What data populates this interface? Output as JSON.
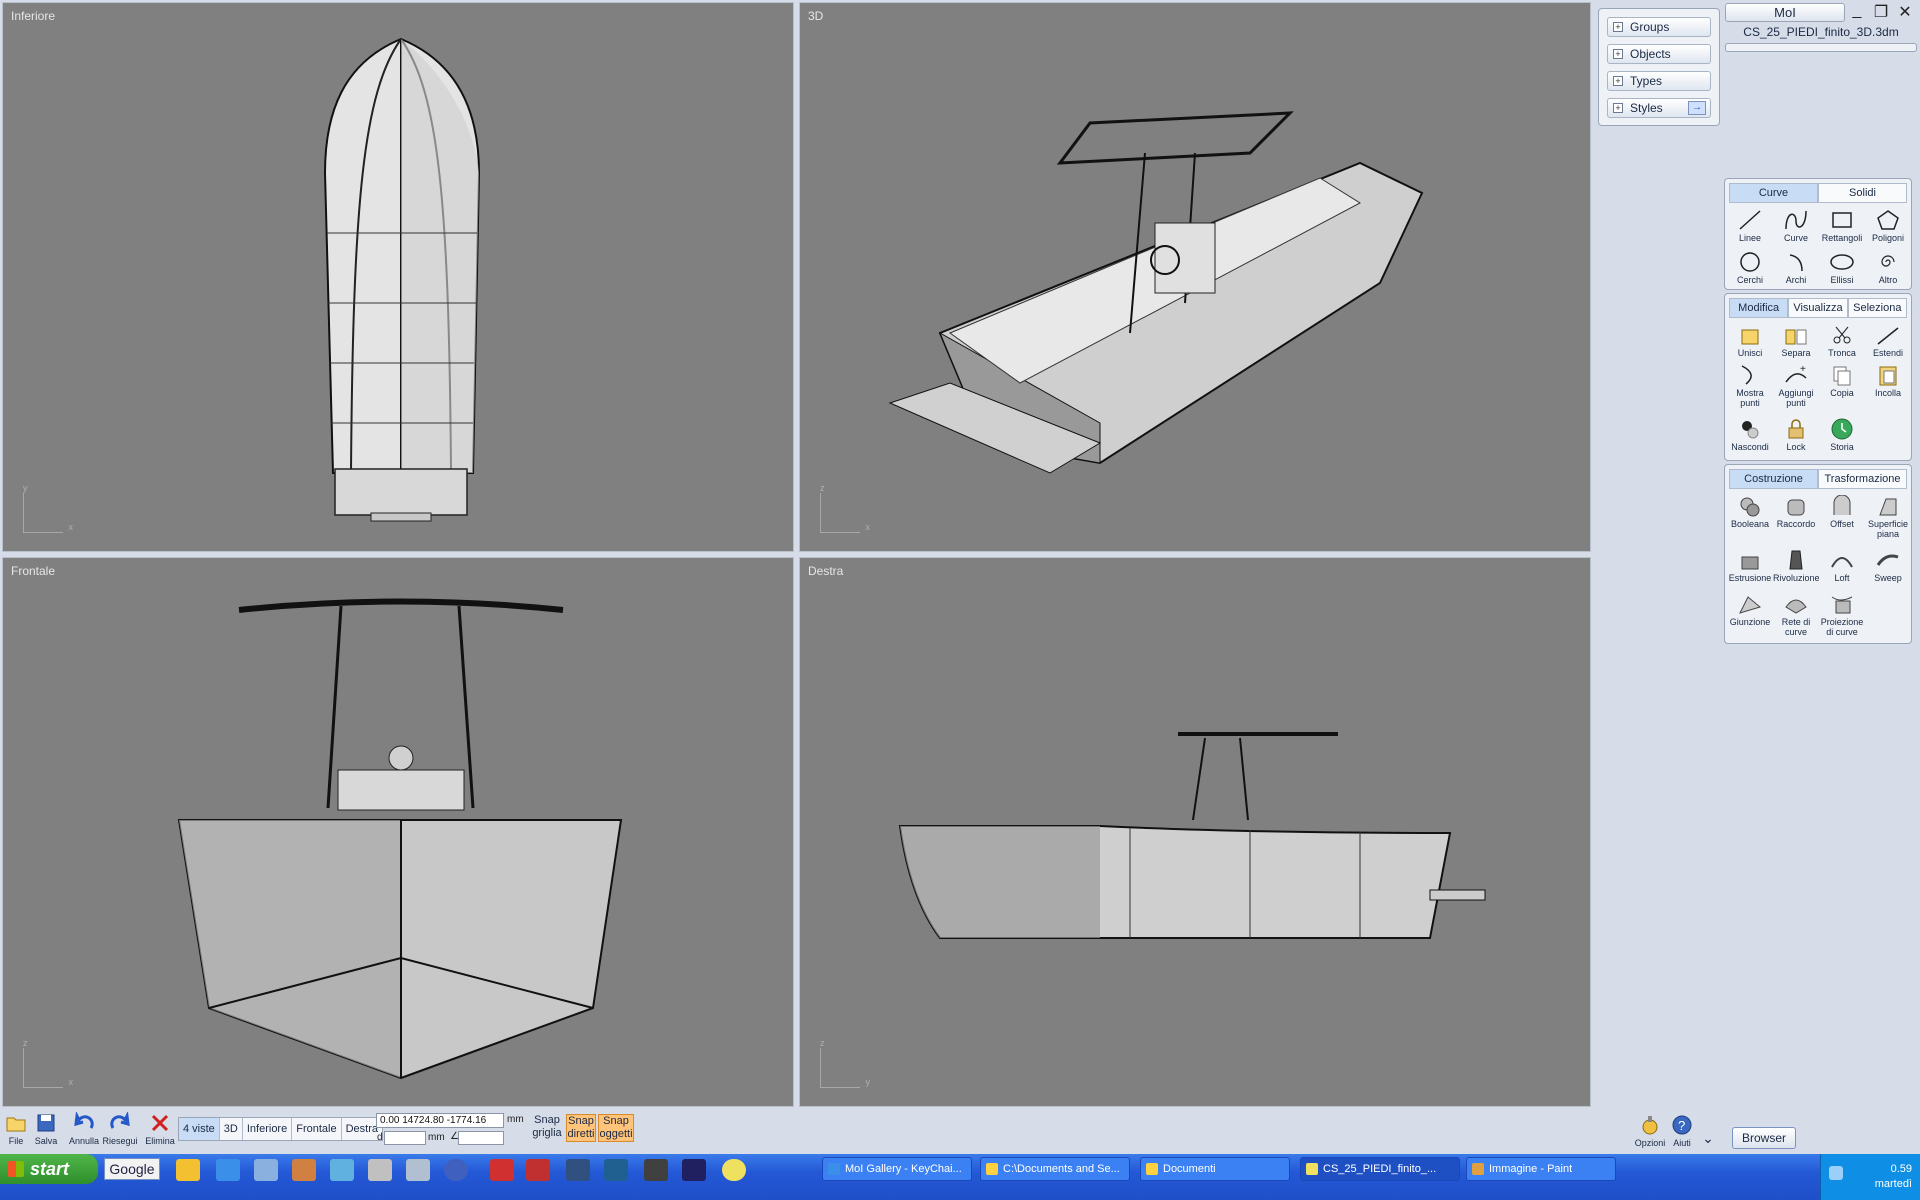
{
  "viewports": {
    "top_left": "Inferiore",
    "top_right": "3D",
    "bottom_left": "Frontale",
    "bottom_right": "Destra"
  },
  "scene_browser": [
    "Groups",
    "Objects",
    "Types",
    "Styles"
  ],
  "title": {
    "app_button": "MoI",
    "filename": "CS_25_PIEDI_finito_3D.3dm"
  },
  "draw_palette": {
    "tabs": [
      "Curve",
      "Solidi"
    ],
    "tools": [
      "Linee",
      "Curve",
      "Rettangoli",
      "Poligoni",
      "Cerchi",
      "Archi",
      "Ellissi",
      "Altro"
    ]
  },
  "edit_palette": {
    "tabs": [
      "Modifica",
      "Visualizza",
      "Seleziona"
    ],
    "tools": [
      "Unisci",
      "Separa",
      "Tronca",
      "Estendi",
      "Mostra punti",
      "Aggiungi punti",
      "Copia",
      "Incolla",
      "Nascondi",
      "Lock",
      "Storia"
    ]
  },
  "construct_palette": {
    "tabs": [
      "Costruzione",
      "Trasformazione"
    ],
    "tools": [
      "Booleana",
      "Raccordo",
      "Offset",
      "Superficie piana",
      "Estrusione",
      "Rivoluzione",
      "Loft",
      "Sweep",
      "Giunzione",
      "Rete di curve",
      "Proiezione di curve"
    ]
  },
  "bottom_toolbar": {
    "file": "File",
    "save": "Salva",
    "undo": "Annulla",
    "redo": "Riesegui",
    "delete": "Elimina",
    "view_tabs": [
      "4 viste",
      "3D",
      "Inferiore",
      "Frontale",
      "Destra"
    ],
    "coordinates": "0.00  14724.80  -1774.16",
    "unit": "mm",
    "distance_prefix": "d",
    "snap_grid": "Snap griglia",
    "snap_direct": "Snap diretti",
    "snap_objects": "Snap oggetti",
    "options": "Opzioni",
    "help": "Aiuti",
    "browser": "Browser"
  },
  "taskbar": {
    "start": "start",
    "google": "Google",
    "tasks": [
      "MoI Gallery - KeyChai...",
      "C:\\Documents and Se...",
      "Documenti",
      "CS_25_PIEDI_finito_...",
      "Immagine - Paint"
    ],
    "clock_time": "0.59",
    "clock_day": "martedì"
  },
  "colors": {
    "viewport_bg": "#808080",
    "ui_bg": "#d6dce8",
    "snap_active": "#ffc37a",
    "taskbar": "#2458d6"
  }
}
